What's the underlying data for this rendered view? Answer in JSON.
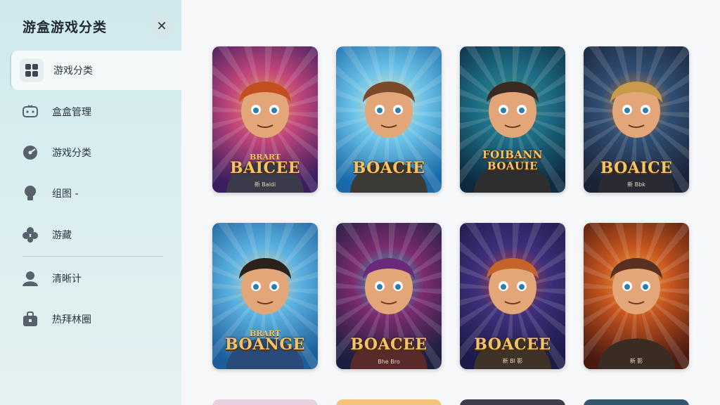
{
  "sidebar": {
    "title": "游盒游戏分类",
    "close_icon": "close-icon",
    "items": [
      {
        "label": "游戏分类",
        "icon": "grid-icon",
        "active": true
      },
      {
        "label": "盒盒管理",
        "icon": "gamepad-icon"
      },
      {
        "label": "游戏分类",
        "icon": "disc-icon"
      },
      {
        "label": "组图 -",
        "icon": "lightbulb-icon"
      },
      {
        "label": "游藏",
        "icon": "clover-icon"
      },
      {
        "label": "清晰计",
        "icon": "user-icon"
      },
      {
        "label": "热拜林圈",
        "icon": "briefcase-icon"
      }
    ]
  },
  "cards": [
    {
      "title": "BAICEE",
      "top": "BRART",
      "sub": "新 Baldi",
      "palette": [
        "#3b1e5e",
        "#c0457a",
        "#e9a24a"
      ]
    },
    {
      "title": "BOACIE",
      "top": "",
      "sub": "",
      "palette": [
        "#1a6aa8",
        "#6cc3e8",
        "#f0e3b0"
      ]
    },
    {
      "title": "FOIBANN BOAUIE",
      "top": "",
      "sub": "",
      "palette": [
        "#0d2a40",
        "#1d6e86",
        "#4a8a7e"
      ]
    },
    {
      "title": "BOAICE",
      "top": "",
      "sub": "新 Bbk",
      "palette": [
        "#1a2236",
        "#2f4d73",
        "#d58a3c"
      ]
    },
    {
      "title": "BOANGE",
      "top": "BRART",
      "sub": "",
      "palette": [
        "#1c5e9a",
        "#59b0e0",
        "#e6d7a0"
      ]
    },
    {
      "title": "BOACEE",
      "top": "",
      "sub": "Bhe Bro",
      "palette": [
        "#1a1f40",
        "#7a2b6e",
        "#2fb8c8"
      ]
    },
    {
      "title": "BOACEE",
      "top": "",
      "sub": "新 Bl 影",
      "palette": [
        "#1b1a48",
        "#3e2f7a",
        "#c44a3a"
      ]
    },
    {
      "title": "",
      "top": "",
      "sub": "新 影",
      "palette": [
        "#4a1a10",
        "#c3531e",
        "#f7a842"
      ]
    }
  ],
  "partial_cards": [
    {
      "color": "#e7d2e2"
    },
    {
      "color": "#f2c47a"
    },
    {
      "color": "#3c3c4a"
    },
    {
      "color": "#34556e"
    }
  ]
}
